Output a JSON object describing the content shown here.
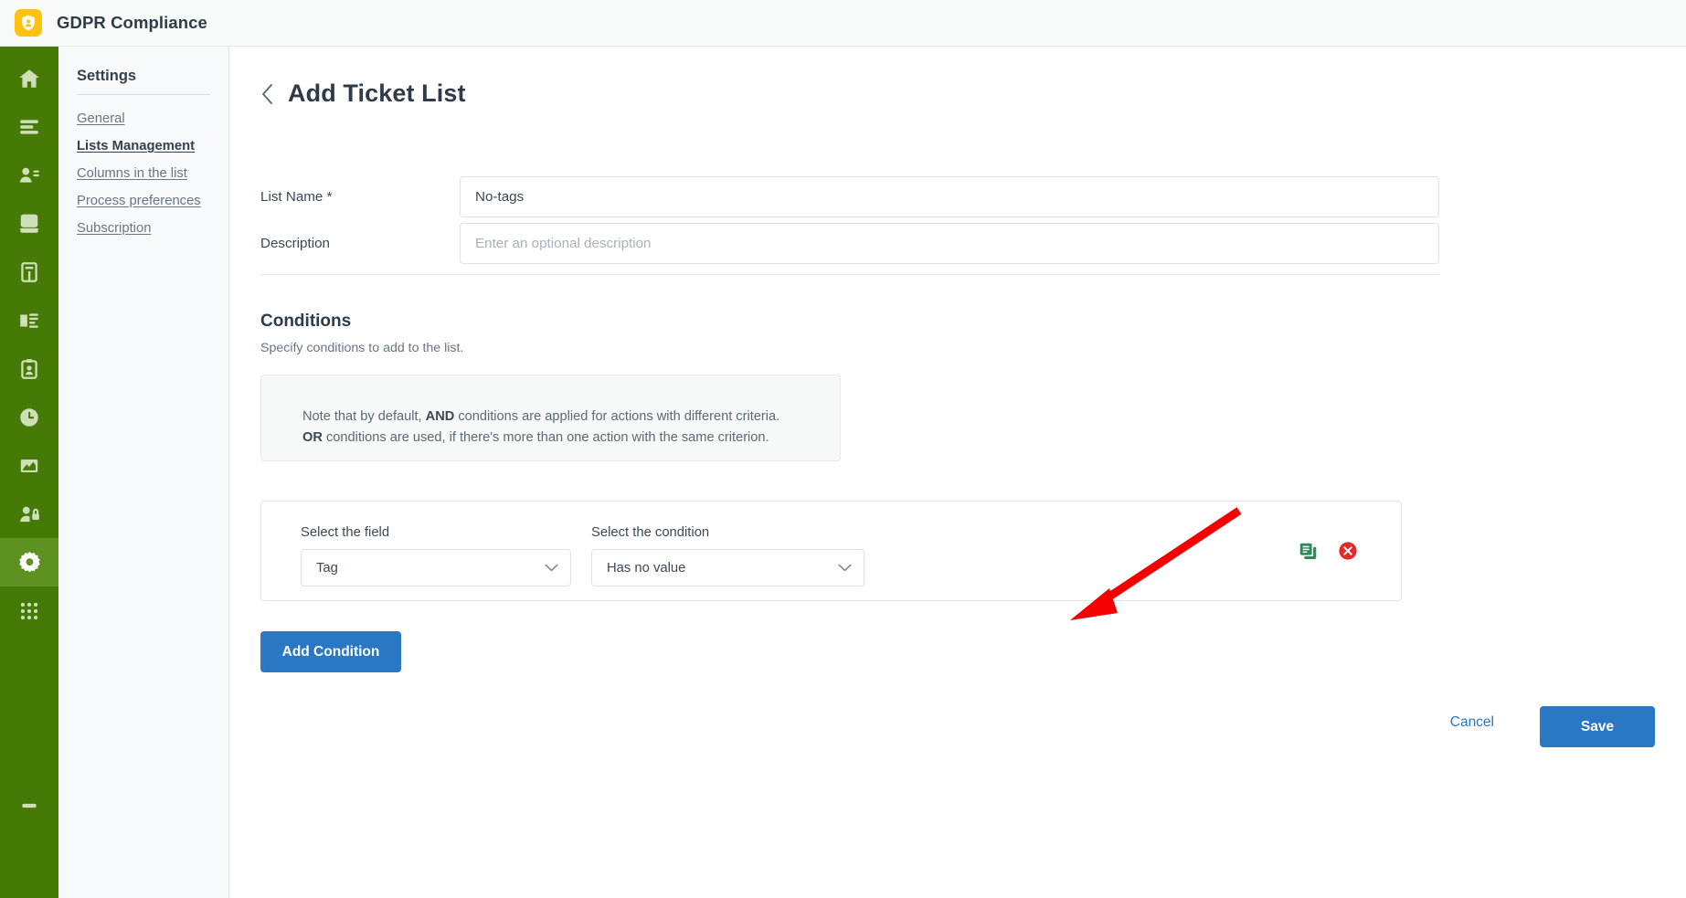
{
  "app": {
    "brand_title": "GDPR Compliance",
    "brand_icon": "shield-person-icon",
    "accent_green": "#457a07",
    "accent_blue": "#2a77c4",
    "brand_yellow": "#ffc20e"
  },
  "rail": {
    "items": [
      {
        "name": "home",
        "icon": "home-icon",
        "active": false
      },
      {
        "name": "lists",
        "icon": "list-lines-icon",
        "active": false
      },
      {
        "name": "contacts",
        "icon": "person-details-icon",
        "active": false
      },
      {
        "name": "database",
        "icon": "database-icon",
        "active": false
      },
      {
        "name": "records",
        "icon": "archive-book-icon",
        "active": false
      },
      {
        "name": "data-transfer",
        "icon": "data-transfer-icon",
        "active": false
      },
      {
        "name": "requests",
        "icon": "clipboard-person-icon",
        "active": false
      },
      {
        "name": "history",
        "icon": "clock-icon",
        "active": false
      },
      {
        "name": "reports",
        "icon": "chart-image-icon",
        "active": false
      },
      {
        "name": "permissions",
        "icon": "person-lock-icon",
        "active": false
      },
      {
        "name": "settings",
        "icon": "gear-icon",
        "active": true
      },
      {
        "name": "apps",
        "icon": "grid-apps-icon",
        "active": false
      }
    ]
  },
  "subnav": {
    "title": "Settings",
    "items": [
      {
        "label": "General",
        "active": false
      },
      {
        "label": "Lists Management",
        "active": true
      },
      {
        "label": "Columns in the list",
        "active": false
      },
      {
        "label": "Process preferences",
        "active": false
      },
      {
        "label": "Subscription",
        "active": false
      }
    ]
  },
  "page": {
    "back_icon": "chevron-left-icon",
    "title": "Add Ticket List"
  },
  "form": {
    "list_name_label": "List Name *",
    "list_name_value": "No-tags",
    "list_name_placeholder": "",
    "description_label": "Description",
    "description_value": "",
    "description_placeholder": "Enter an optional description"
  },
  "conditions": {
    "section_title": "Conditions",
    "section_subtitle": "Specify conditions to add to the list.",
    "note_line1_pre": "Note that by default, ",
    "note_line1_bold": "AND",
    "note_line1_post": " conditions are applied for actions with different criteria.",
    "note_line2_bold": "OR",
    "note_line2_post": " conditions are used, if there's more than one action with the same criterion.",
    "field_label": "Select the field",
    "field_value": "Tag",
    "condition_label": "Select the condition",
    "condition_value": "Has no value",
    "caret_icon": "chevron-down-icon",
    "duplicate_icon": "duplicate-icon",
    "duplicate_color": "#2e8b57",
    "delete_icon": "delete-circle-icon",
    "delete_color": "#e02b2b",
    "add_condition_label": "Add Condition"
  },
  "footer": {
    "cancel_label": "Cancel",
    "save_label": "Save"
  },
  "annotation": {
    "arrow_icon": "red-pointer-arrow",
    "arrow_color": "#f50000"
  }
}
